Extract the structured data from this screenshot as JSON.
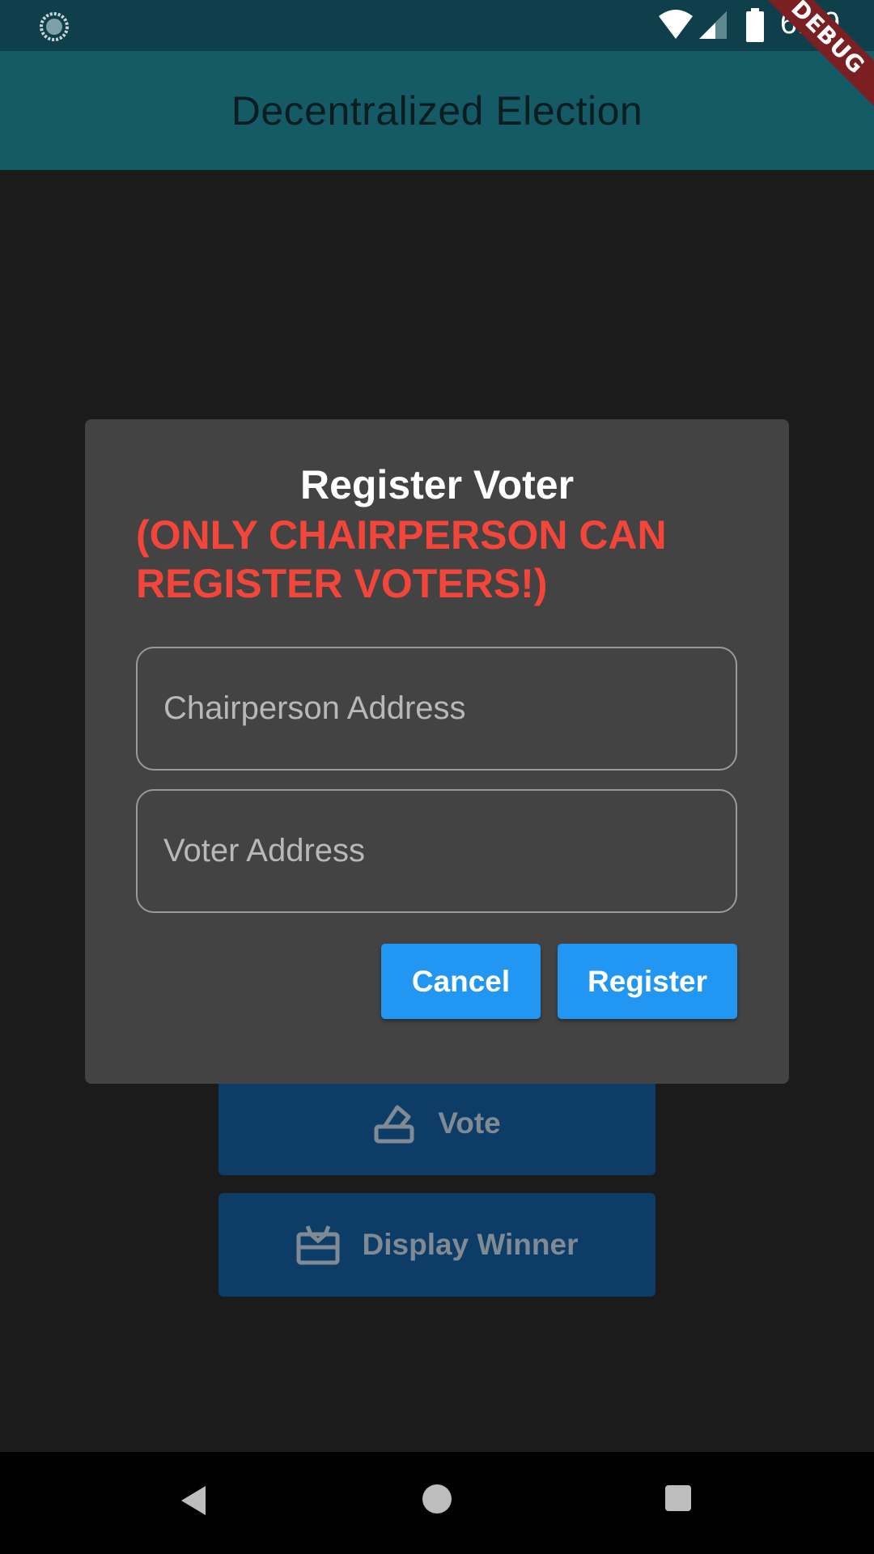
{
  "status_bar": {
    "time": "6:29",
    "icons": [
      "sync-icon",
      "wifi-icon",
      "signal-icon",
      "battery-icon"
    ]
  },
  "debug_banner": "DEBUG",
  "app_bar": {
    "title": "Decentralized Election"
  },
  "background": {
    "vote_label": "Vote",
    "display_winner_label": "Display Winner"
  },
  "dialog": {
    "title": "Register Voter",
    "warning": "(ONLY CHAIRPERSON CAN REGISTER VOTERS!)",
    "chairperson_field": {
      "placeholder": "Chairperson Address",
      "value": ""
    },
    "voter_field": {
      "placeholder": "Voter Address",
      "value": ""
    },
    "cancel_label": "Cancel",
    "register_label": "Register"
  },
  "colors": {
    "status_bar": "#0f3f4a",
    "app_bar": "#155b66",
    "dialog_bg": "#434343",
    "warning_text": "#f4453a",
    "button": "#2196f3"
  },
  "nav_bar": {
    "icons": [
      "back-icon",
      "home-icon",
      "recent-apps-icon"
    ]
  }
}
